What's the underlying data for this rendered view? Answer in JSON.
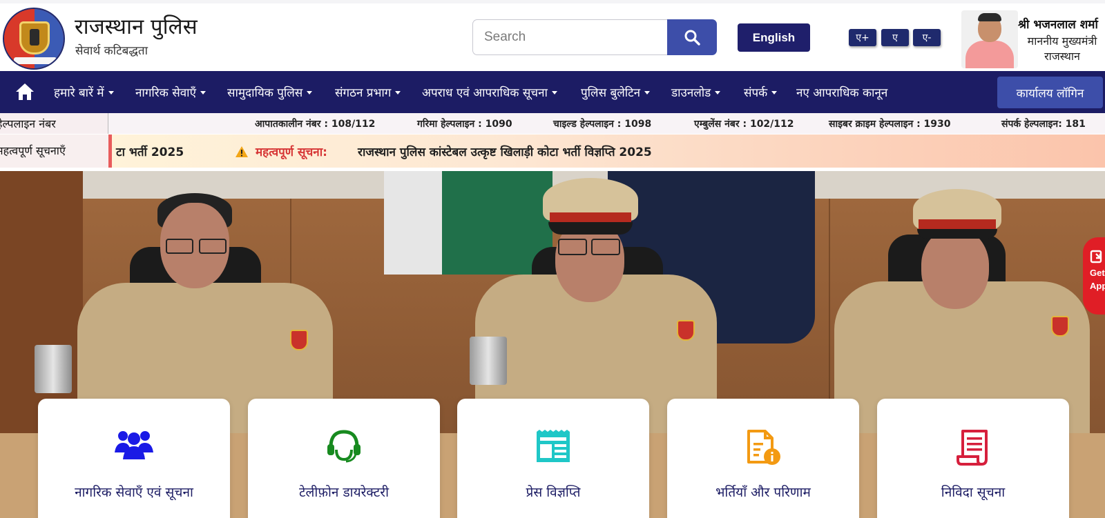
{
  "header": {
    "site_title": "राजस्थान पुलिस",
    "tagline": "सेवार्थ कटिबद्धता",
    "search_placeholder": "Search",
    "language_button": "English",
    "font_sizes": [
      "ए+",
      "ए",
      "ए-"
    ],
    "cm": {
      "name": "श्री भजनलाल शर्मा",
      "role_line1": "माननीय मुख्यमंत्री",
      "role_line2": "राजस्थान"
    }
  },
  "nav": {
    "items": [
      {
        "label": "हमारे बारें में",
        "dropdown": true
      },
      {
        "label": "नागरिक सेवाएँ",
        "dropdown": true
      },
      {
        "label": "सामुदायिक पुलिस",
        "dropdown": true
      },
      {
        "label": "संगठन प्रभाग",
        "dropdown": true
      },
      {
        "label": "अपराध एवं आपराधिक सूचना",
        "dropdown": true
      },
      {
        "label": "पुलिस बुलेटिन",
        "dropdown": true
      },
      {
        "label": "डाउनलोड",
        "dropdown": true
      },
      {
        "label": "संपर्क",
        "dropdown": true
      },
      {
        "label": "नए आपराधिक कानून",
        "dropdown": false
      }
    ],
    "login_button": "कार्यालय लॉगिन"
  },
  "helpline": {
    "label": "हेल्पलाइन नंबर",
    "items": [
      "आपातकालीन नंबर : 108/112",
      "गरिमा हेल्पलाइन : 1090",
      "चाइल्ड हेल्पलाइन : 1098",
      "एम्बुलेंस नंबर : 102/112",
      "साइबर क्राइम हेल्पलाइन : 1930",
      "संपर्क हेल्पलाइन: 181"
    ]
  },
  "notices": {
    "label": "महत्वपूर्ण सूचनाएँ",
    "previous_tail": "टा भर्ती 2025",
    "prefix": "महत्वपूर्ण सूचना:",
    "text": "राजस्थान पुलिस कांस्टेबल उत्कृष्ट खिलाड़ी कोटा भर्ती विज्ञप्ति 2025"
  },
  "get_app": {
    "line1": "Get",
    "line2": "App"
  },
  "carousel": {
    "prev_label": "‹",
    "next_label": "›"
  },
  "cards": [
    {
      "label": "नागरिक सेवाएँ एवं सूचना",
      "icon": "users-group-icon",
      "color": "#1a1ae6"
    },
    {
      "label": "टेलीफ़ोन डायरेक्टरी",
      "icon": "headset-icon",
      "color": "#178a1f"
    },
    {
      "label": "प्रेस विज्ञप्ति",
      "icon": "newspaper-icon",
      "color": "#1fc7c7"
    },
    {
      "label": "भर्तियाँ और परिणाम",
      "icon": "document-info-icon",
      "color": "#f39a12"
    },
    {
      "label": "निविदा सूचना",
      "icon": "scroll-document-icon",
      "color": "#d61f3c"
    }
  ],
  "colors": {
    "nav_bg": "#1c1c64",
    "accent": "#3d4ea9",
    "notice_red": "#d63535"
  }
}
